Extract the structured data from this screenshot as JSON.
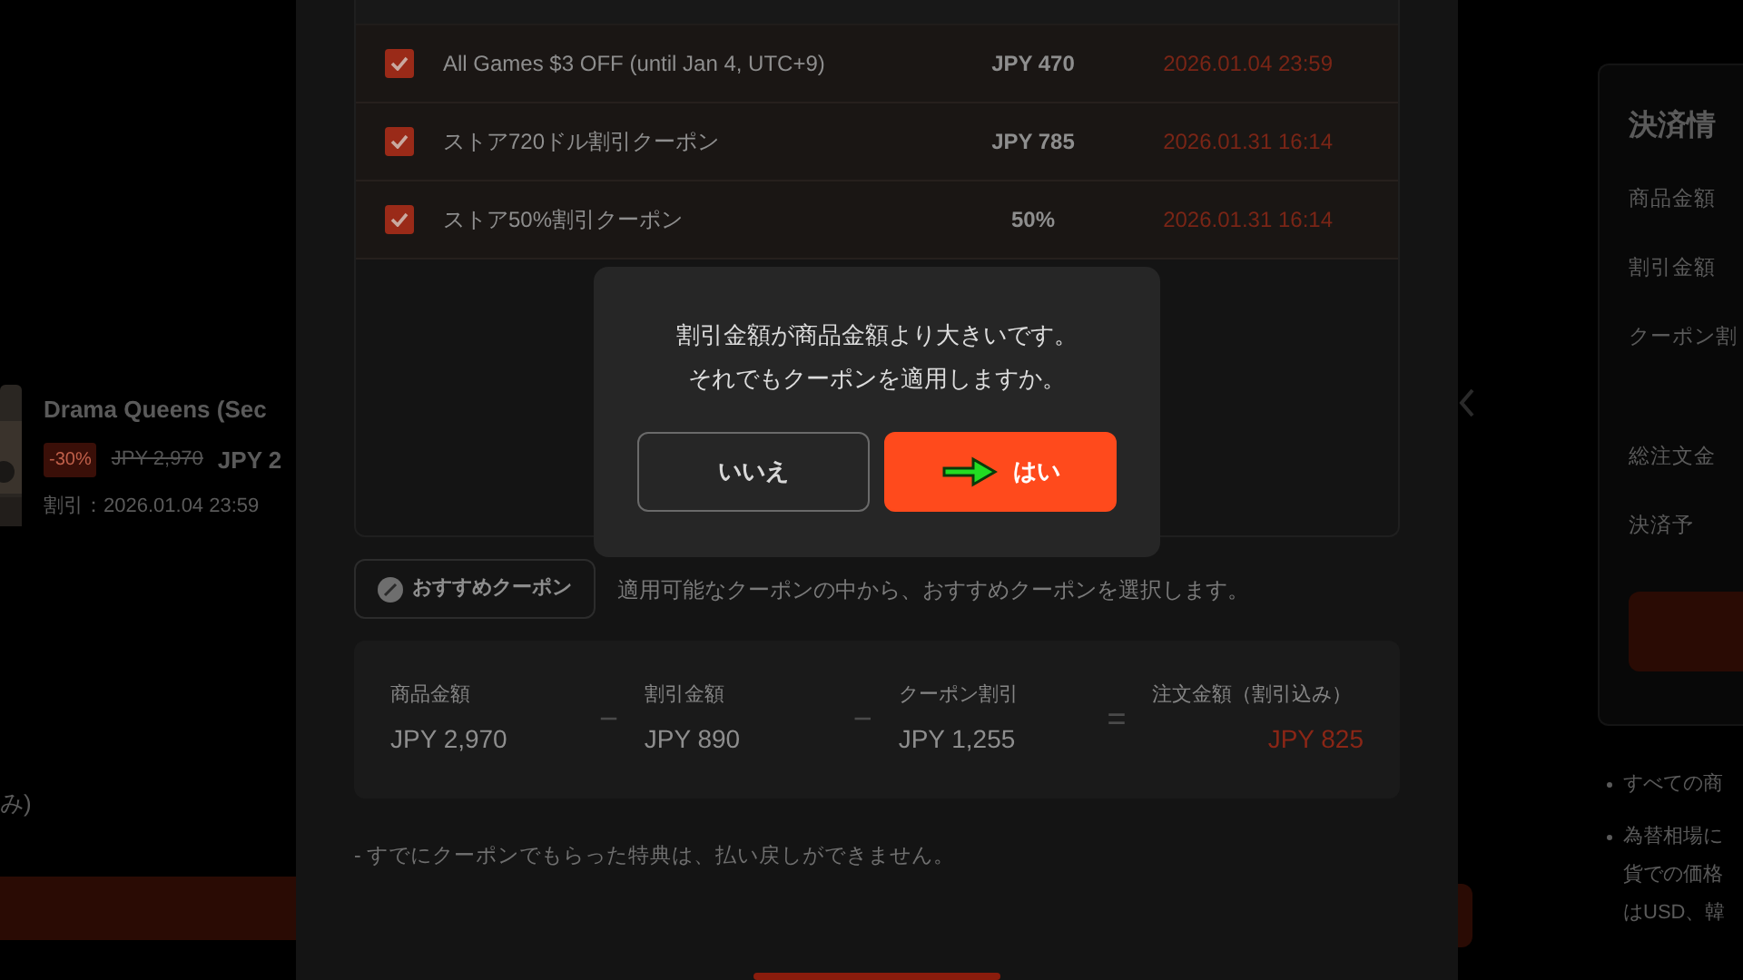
{
  "background_page": {
    "product": {
      "title": "Drama Queens (Sec",
      "discount": "-30%",
      "original_price": "JPY 2,970",
      "price": "JPY 2",
      "sale_period": "割引：2026.01.04 23:59"
    },
    "left_note": "み)",
    "payment_panel": {
      "title": "決済情",
      "rows": [
        "商品金額",
        "割引金額",
        "クーポン割",
        "総注文金",
        "決済予"
      ]
    },
    "notes": [
      {
        "lines": [
          "すべての商"
        ]
      },
      {
        "lines": [
          "為替相場に",
          "貨での価格",
          "はUSD、韓"
        ]
      }
    ]
  },
  "coupon_modal": {
    "coupons": [
      {
        "name": "All Games $3 OFF (until Jan 4, UTC+9)",
        "value": "JPY 470",
        "expiry": "2026.01.04 23:59",
        "checked": true
      },
      {
        "name": "ストア720ドル割引クーポン",
        "value": "JPY 785",
        "expiry": "2026.01.31 16:14",
        "checked": true
      },
      {
        "name": "ストア50%割引クーポン",
        "value": "50%",
        "expiry": "2026.01.31 16:14",
        "checked": true
      }
    ],
    "recommend_button": "おすすめクーポン",
    "recommend_hint": "適用可能なクーポンの中から、おすすめクーポンを選択します。",
    "summary": [
      {
        "label": "商品金額",
        "amount": "JPY 2,970",
        "kind": "term"
      },
      {
        "label": "割引金額",
        "amount": "JPY 890",
        "kind": "term"
      },
      {
        "label": "クーポン割引",
        "amount": "JPY 1,255",
        "kind": "term"
      },
      {
        "label": "注文金額（割引込み）",
        "amount": "JPY 825",
        "kind": "total"
      }
    ],
    "operators": [
      "−",
      "−",
      "="
    ],
    "note": "- すでにクーポンでもらった特典は、払い戻しができません。"
  },
  "confirm_dialog": {
    "message": [
      "割引金額が商品金額より大きいです。",
      "それでもクーポンを適用しますか。"
    ],
    "buttons": [
      {
        "label": "いいえ",
        "kind": "secondary"
      },
      {
        "label": "はい",
        "kind": "primary",
        "pointer": true
      }
    ]
  }
}
